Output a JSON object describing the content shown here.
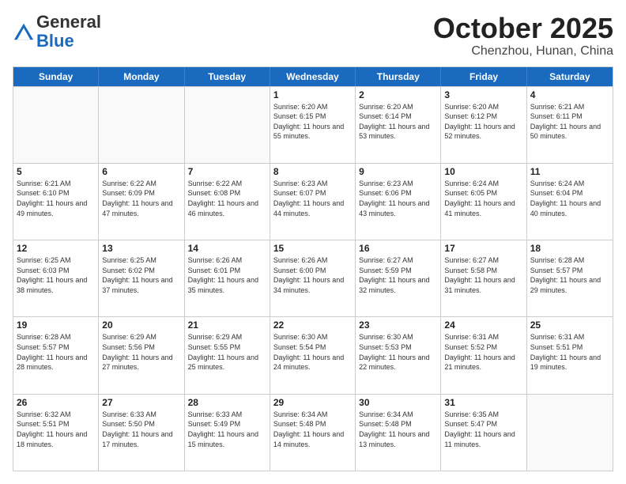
{
  "header": {
    "logo_general": "General",
    "logo_blue": "Blue",
    "month": "October 2025",
    "location": "Chenzhou, Hunan, China"
  },
  "weekdays": [
    "Sunday",
    "Monday",
    "Tuesday",
    "Wednesday",
    "Thursday",
    "Friday",
    "Saturday"
  ],
  "weeks": [
    [
      {
        "day": "",
        "info": ""
      },
      {
        "day": "",
        "info": ""
      },
      {
        "day": "",
        "info": ""
      },
      {
        "day": "1",
        "info": "Sunrise: 6:20 AM\nSunset: 6:15 PM\nDaylight: 11 hours\nand 55 minutes."
      },
      {
        "day": "2",
        "info": "Sunrise: 6:20 AM\nSunset: 6:14 PM\nDaylight: 11 hours\nand 53 minutes."
      },
      {
        "day": "3",
        "info": "Sunrise: 6:20 AM\nSunset: 6:12 PM\nDaylight: 11 hours\nand 52 minutes."
      },
      {
        "day": "4",
        "info": "Sunrise: 6:21 AM\nSunset: 6:11 PM\nDaylight: 11 hours\nand 50 minutes."
      }
    ],
    [
      {
        "day": "5",
        "info": "Sunrise: 6:21 AM\nSunset: 6:10 PM\nDaylight: 11 hours\nand 49 minutes."
      },
      {
        "day": "6",
        "info": "Sunrise: 6:22 AM\nSunset: 6:09 PM\nDaylight: 11 hours\nand 47 minutes."
      },
      {
        "day": "7",
        "info": "Sunrise: 6:22 AM\nSunset: 6:08 PM\nDaylight: 11 hours\nand 46 minutes."
      },
      {
        "day": "8",
        "info": "Sunrise: 6:23 AM\nSunset: 6:07 PM\nDaylight: 11 hours\nand 44 minutes."
      },
      {
        "day": "9",
        "info": "Sunrise: 6:23 AM\nSunset: 6:06 PM\nDaylight: 11 hours\nand 43 minutes."
      },
      {
        "day": "10",
        "info": "Sunrise: 6:24 AM\nSunset: 6:05 PM\nDaylight: 11 hours\nand 41 minutes."
      },
      {
        "day": "11",
        "info": "Sunrise: 6:24 AM\nSunset: 6:04 PM\nDaylight: 11 hours\nand 40 minutes."
      }
    ],
    [
      {
        "day": "12",
        "info": "Sunrise: 6:25 AM\nSunset: 6:03 PM\nDaylight: 11 hours\nand 38 minutes."
      },
      {
        "day": "13",
        "info": "Sunrise: 6:25 AM\nSunset: 6:02 PM\nDaylight: 11 hours\nand 37 minutes."
      },
      {
        "day": "14",
        "info": "Sunrise: 6:26 AM\nSunset: 6:01 PM\nDaylight: 11 hours\nand 35 minutes."
      },
      {
        "day": "15",
        "info": "Sunrise: 6:26 AM\nSunset: 6:00 PM\nDaylight: 11 hours\nand 34 minutes."
      },
      {
        "day": "16",
        "info": "Sunrise: 6:27 AM\nSunset: 5:59 PM\nDaylight: 11 hours\nand 32 minutes."
      },
      {
        "day": "17",
        "info": "Sunrise: 6:27 AM\nSunset: 5:58 PM\nDaylight: 11 hours\nand 31 minutes."
      },
      {
        "day": "18",
        "info": "Sunrise: 6:28 AM\nSunset: 5:57 PM\nDaylight: 11 hours\nand 29 minutes."
      }
    ],
    [
      {
        "day": "19",
        "info": "Sunrise: 6:28 AM\nSunset: 5:57 PM\nDaylight: 11 hours\nand 28 minutes."
      },
      {
        "day": "20",
        "info": "Sunrise: 6:29 AM\nSunset: 5:56 PM\nDaylight: 11 hours\nand 27 minutes."
      },
      {
        "day": "21",
        "info": "Sunrise: 6:29 AM\nSunset: 5:55 PM\nDaylight: 11 hours\nand 25 minutes."
      },
      {
        "day": "22",
        "info": "Sunrise: 6:30 AM\nSunset: 5:54 PM\nDaylight: 11 hours\nand 24 minutes."
      },
      {
        "day": "23",
        "info": "Sunrise: 6:30 AM\nSunset: 5:53 PM\nDaylight: 11 hours\nand 22 minutes."
      },
      {
        "day": "24",
        "info": "Sunrise: 6:31 AM\nSunset: 5:52 PM\nDaylight: 11 hours\nand 21 minutes."
      },
      {
        "day": "25",
        "info": "Sunrise: 6:31 AM\nSunset: 5:51 PM\nDaylight: 11 hours\nand 19 minutes."
      }
    ],
    [
      {
        "day": "26",
        "info": "Sunrise: 6:32 AM\nSunset: 5:51 PM\nDaylight: 11 hours\nand 18 minutes."
      },
      {
        "day": "27",
        "info": "Sunrise: 6:33 AM\nSunset: 5:50 PM\nDaylight: 11 hours\nand 17 minutes."
      },
      {
        "day": "28",
        "info": "Sunrise: 6:33 AM\nSunset: 5:49 PM\nDaylight: 11 hours\nand 15 minutes."
      },
      {
        "day": "29",
        "info": "Sunrise: 6:34 AM\nSunset: 5:48 PM\nDaylight: 11 hours\nand 14 minutes."
      },
      {
        "day": "30",
        "info": "Sunrise: 6:34 AM\nSunset: 5:48 PM\nDaylight: 11 hours\nand 13 minutes."
      },
      {
        "day": "31",
        "info": "Sunrise: 6:35 AM\nSunset: 5:47 PM\nDaylight: 11 hours\nand 11 minutes."
      },
      {
        "day": "",
        "info": ""
      }
    ]
  ]
}
